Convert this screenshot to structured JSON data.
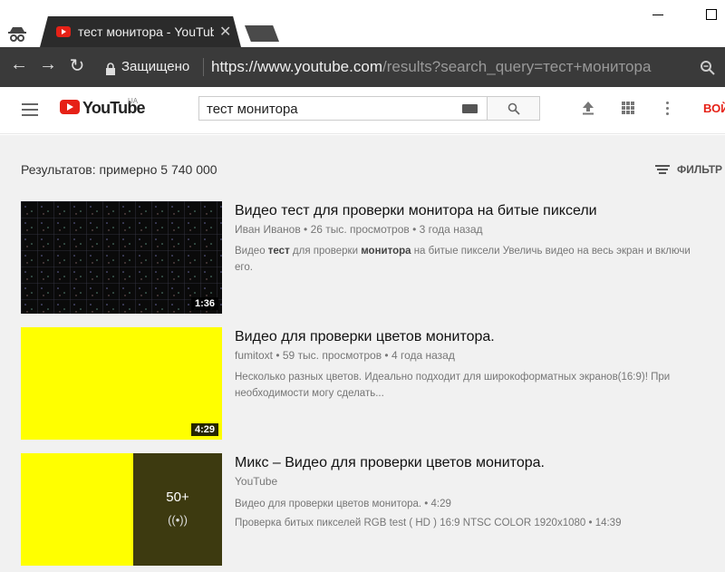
{
  "browser": {
    "tab_title": "тест монитора - YouTube",
    "secure_label": "Защищено",
    "url_host": "https://www.youtube.com",
    "url_path": "/results?search_query=тест+монитора"
  },
  "header": {
    "logo_text": "YouTube",
    "logo_region": "UA",
    "search_value": "тест монитора",
    "signin_label": "ВОЙ"
  },
  "results": {
    "count_label": "Результатов: примерно 5 740 000",
    "filter_label": "ФИЛЬТР"
  },
  "videos": [
    {
      "title": "Видео тест для проверки монитора на битые пиксели",
      "meta": "Иван Иванов • 26 тыс. просмотров • 3 года назад",
      "desc_parts": [
        "Видео ",
        "тест",
        " для проверки ",
        "монитора",
        " на битые пиксели Увеличь видео на весь экран и включи его."
      ],
      "duration": "1:36"
    },
    {
      "title": "Видео для проверки цветов монитора.",
      "meta": "fumitoxt • 59 тыс. просмотров • 4 года назад",
      "desc": "Несколько разных цветов. Идеально подходит для широкоформатных экранов(16:9)! При необходимости могу сделать...",
      "duration": "4:29"
    },
    {
      "title": "Микс – Видео для проверки цветов монитора.",
      "meta": "YouTube",
      "line1": "Видео для проверки цветов монитора. • 4:29",
      "line2": "Проверка битых пикселей RGB test ( HD ) 16:9 NTSC COLOR 1920x1080 • 14:39",
      "mix_count": "50+",
      "mix_icon": "((•))"
    }
  ],
  "colors": {
    "yt_red": "#e62117",
    "thumb_yellow": "#ffff00",
    "mix_panel": "#3d3a10"
  },
  "icons": [
    "incognito-icon",
    "close-icon",
    "back-icon",
    "forward-icon",
    "reload-icon",
    "lock-icon",
    "zoom-icon",
    "menu-icon",
    "keyboard-icon",
    "search-icon",
    "upload-icon",
    "apps-icon",
    "more-icon",
    "filter-icon",
    "radio-icon"
  ]
}
